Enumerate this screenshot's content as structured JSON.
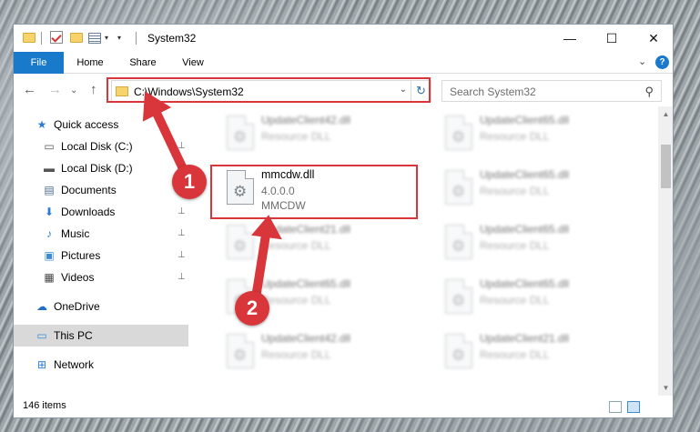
{
  "window": {
    "title": "System32",
    "controls": {
      "minimize": "—",
      "maximize": "☐",
      "close": "✕"
    }
  },
  "ribbon": {
    "tabs": [
      "File",
      "Home",
      "Share",
      "View"
    ],
    "expand_glyph": "⌄",
    "help_glyph": "?"
  },
  "nav": {
    "back": "←",
    "forward": "→",
    "recent": "⌄",
    "up": "↑",
    "address": "C:\\Windows\\System32",
    "address_dropdown": "⌄",
    "refresh": "↻",
    "search_placeholder": "Search System32",
    "search_icon": "⚲"
  },
  "sidebar": {
    "items": [
      {
        "label": "Quick access",
        "icon": "star-icon",
        "glyph": "★",
        "color": "#2b7bd6",
        "pinned": false
      },
      {
        "label": "Local Disk (C:)",
        "icon": "drive-icon",
        "glyph": "▭",
        "color": "#555555",
        "pinned": true
      },
      {
        "label": "Local Disk (D:)",
        "icon": "drive-icon",
        "glyph": "▬",
        "color": "#555555",
        "pinned": true
      },
      {
        "label": "Documents",
        "icon": "documents-icon",
        "glyph": "▤",
        "color": "#4a6d91",
        "pinned": true
      },
      {
        "label": "Downloads",
        "icon": "downloads-icon",
        "glyph": "⬇",
        "color": "#2b7bd6",
        "pinned": true
      },
      {
        "label": "Music",
        "icon": "music-icon",
        "glyph": "♪",
        "color": "#2b7bd6",
        "pinned": true
      },
      {
        "label": "Pictures",
        "icon": "pictures-icon",
        "glyph": "▣",
        "color": "#3a8bd6",
        "pinned": true
      },
      {
        "label": "Videos",
        "icon": "videos-icon",
        "glyph": "▦",
        "color": "#444444",
        "pinned": true
      },
      {
        "label": "OneDrive",
        "icon": "cloud-icon",
        "glyph": "☁",
        "color": "#1e6fc7",
        "pinned": false
      },
      {
        "label": "This PC",
        "icon": "computer-icon",
        "glyph": "▭",
        "color": "#3a8bd6",
        "pinned": false
      },
      {
        "label": "Network",
        "icon": "network-icon",
        "glyph": "⊞",
        "color": "#2b7bd6",
        "pinned": false
      }
    ],
    "pin_glyph": "📌"
  },
  "files": {
    "focused": {
      "name": "mmcdw.dll",
      "version": "4.0.0.0",
      "description": "MMCDW"
    },
    "blurred": [
      {
        "name": "UpdateClient42.dll",
        "type": "Resource DLL"
      },
      {
        "name": "UpdateClient65.dll",
        "type": "Resource DLL"
      },
      {
        "name": "UpdateClient65.dll",
        "type": "Resource DLL"
      },
      {
        "name": "UpdateClient21.dll",
        "type": "Resource DLL"
      },
      {
        "name": "UpdateClient65.dll",
        "type": "Resource DLL"
      },
      {
        "name": "UpdateClient65.dll",
        "type": "Resource DLL"
      },
      {
        "name": "UpdateClient42.dll",
        "type": "Resource DLL"
      },
      {
        "name": "UpdateClient65.dll",
        "type": "Resource DLL"
      },
      {
        "name": "UpdateClient21.dll",
        "type": "Resource DLL"
      }
    ]
  },
  "scrollbar": {
    "up": "▲",
    "down": "▼"
  },
  "status": {
    "item_count": "146 items"
  },
  "annotations": {
    "step1": "1",
    "step2": "2",
    "color": "#d8363a"
  }
}
